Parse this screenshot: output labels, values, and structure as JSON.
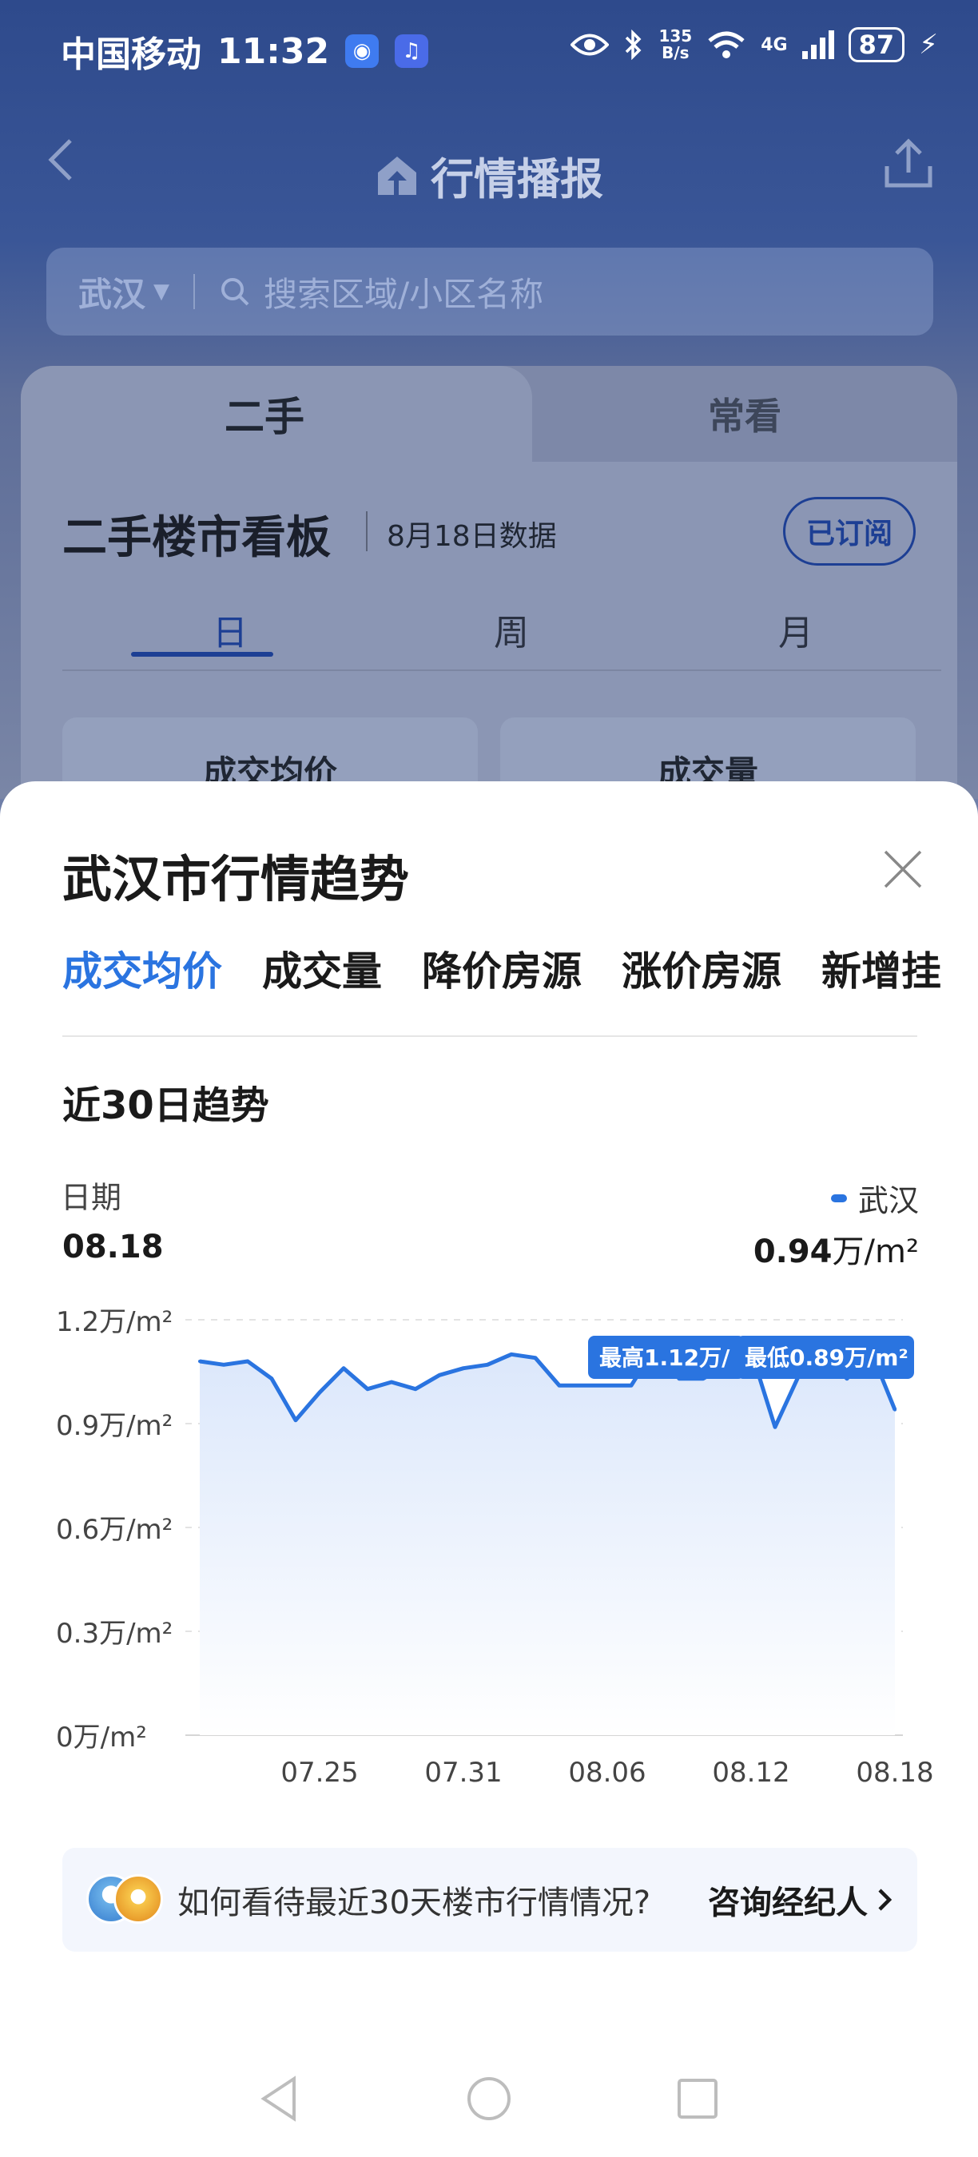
{
  "status": {
    "carrier": "中国移动",
    "time": "11:32",
    "net_speed_top": "135",
    "net_speed_bottom": "B/s",
    "network": "4G",
    "battery": "87"
  },
  "nav": {
    "title": "行情播报"
  },
  "search": {
    "city": "武汉",
    "placeholder": "搜索区域/小区名称"
  },
  "background_card": {
    "tab_active": "二手",
    "tab_inactive": "常看",
    "board_title": "二手楼市看板",
    "board_date": "8月18日数据",
    "subscribe_label": "已订阅",
    "period_tabs": [
      "日",
      "周",
      "月"
    ],
    "metric_boxes": [
      "成交均价",
      "成交量"
    ]
  },
  "sheet": {
    "title": "武汉市行情趋势",
    "metric_tabs": [
      "成交均价",
      "成交量",
      "降价房源",
      "涨价房源",
      "新增挂"
    ],
    "active_tab": "成交均价",
    "trend_title": "近30日趋势",
    "date_label": "日期",
    "date_value": "08.18",
    "legend_name": "武汉",
    "legend_value": "0.94",
    "legend_unit": "万/m²",
    "consult_question": "如何看待最近30天楼市行情情况?",
    "consult_link": "咨询经纪人"
  },
  "chart_data": {
    "type": "area",
    "ylim": [
      0,
      1.2
    ],
    "y_ticks": [
      {
        "value": 1.2,
        "label": "1.2万/m²"
      },
      {
        "value": 0.9,
        "label": "0.9万/m²"
      },
      {
        "value": 0.6,
        "label": "0.6万/m²"
      },
      {
        "value": 0.3,
        "label": "0.3万/m²"
      },
      {
        "value": 0,
        "label": "0万/m²"
      }
    ],
    "x_tick_labels": [
      "07.25",
      "07.31",
      "08.06",
      "08.12",
      "08.18"
    ],
    "x_tick_index": [
      5,
      11,
      17,
      23,
      29
    ],
    "series": [
      {
        "name": "武汉",
        "color": "#2a74e0",
        "values": [
          1.08,
          1.07,
          1.08,
          1.03,
          0.91,
          0.99,
          1.06,
          1.0,
          1.02,
          1.0,
          1.04,
          1.06,
          1.07,
          1.1,
          1.09,
          1.01,
          1.01,
          1.01,
          1.01,
          1.12,
          1.03,
          1.03,
          1.07,
          1.11,
          0.89,
          1.04,
          1.1,
          1.03,
          1.11,
          0.94
        ]
      }
    ],
    "annotations": [
      "最高1.12万/",
      "最低0.89万/m²"
    ],
    "grid": true
  }
}
